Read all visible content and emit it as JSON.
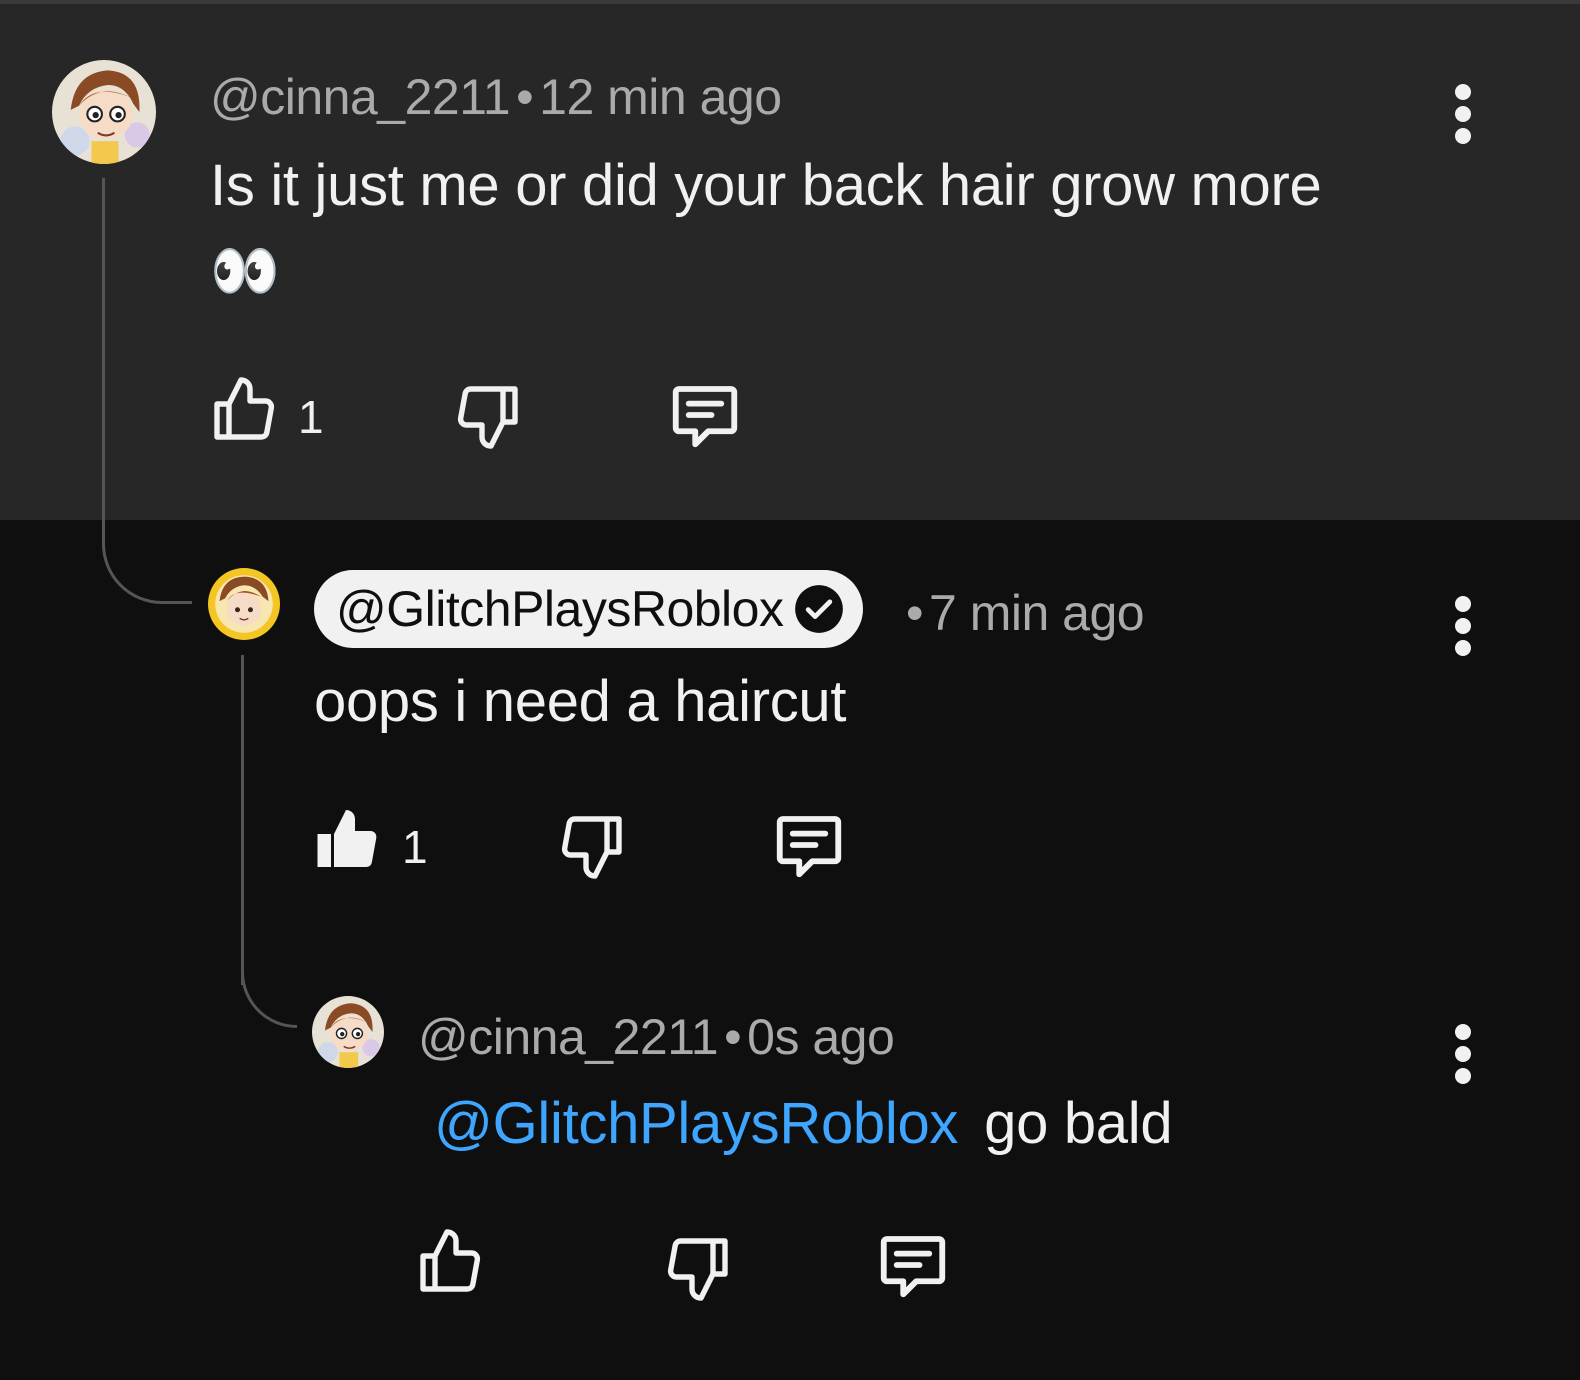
{
  "comments": [
    {
      "author": "@cinna_2211",
      "time": "12 min ago",
      "text": "Is it just me or did your back hair grow more",
      "emoji": "👀",
      "likes": "1",
      "liked": false
    },
    {
      "author": "@GlitchPlaysRoblox",
      "is_creator": true,
      "time": "7 min ago",
      "text": "oops i need a haircut",
      "likes": "1",
      "liked": true
    },
    {
      "author": "@cinna_2211",
      "time": "0s ago",
      "mention": "@GlitchPlaysRoblox",
      "text": "go bald",
      "likes": "",
      "liked": false
    }
  ],
  "separator": "•",
  "colors": {
    "background": "#0f0f0f",
    "highlighted_comment_bg": "#272727",
    "meta_text": "#aaaaaa",
    "mention": "#3ea6ff",
    "creator_pill": "#f1f1f1"
  },
  "icons": {
    "like": "thumb-up-icon",
    "like_filled": "thumb-up-filled-icon",
    "dislike": "thumb-down-icon",
    "reply": "reply-comment-icon",
    "more": "more-vert-icon",
    "verified": "verified-check-icon"
  }
}
